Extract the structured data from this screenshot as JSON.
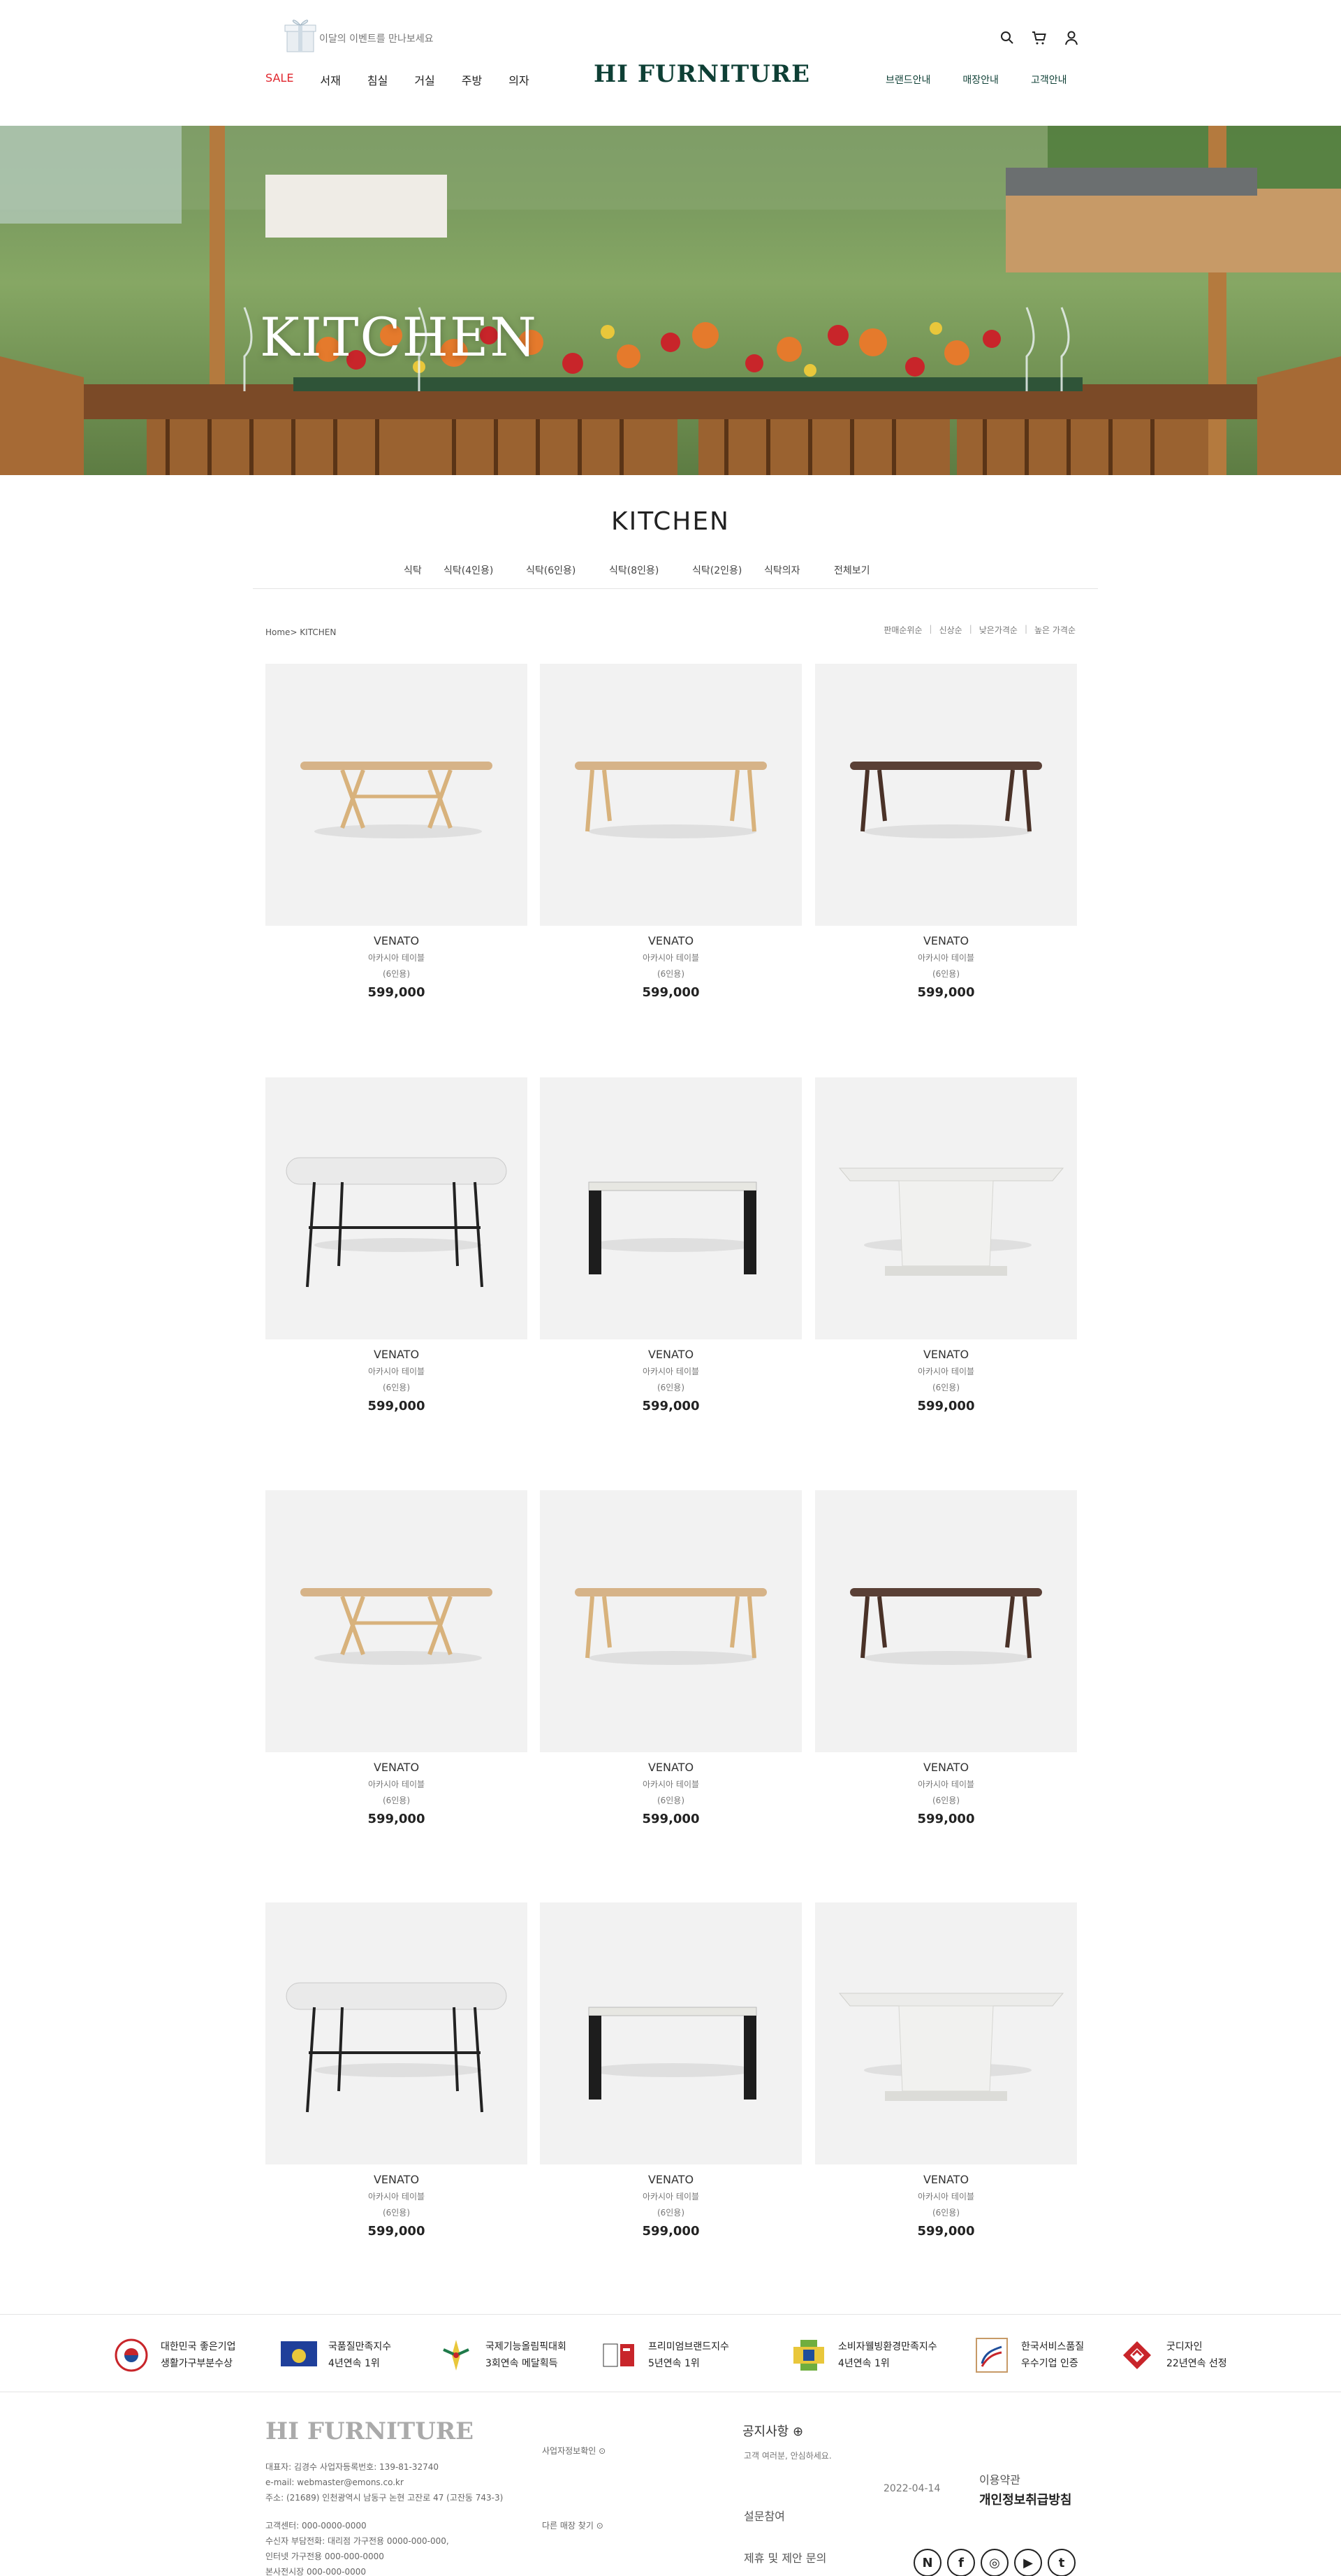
{
  "header": {
    "event_text": "이달의 이벤트를 만나보세요",
    "logo": "HI FURNITURE",
    "nav_left": [
      "SALE",
      "서재",
      "침실",
      "거실",
      "주방",
      "의자"
    ],
    "nav_right": [
      "브랜드안내",
      "매장안내",
      "고객안내"
    ]
  },
  "hero": {
    "title": "KITCHEN"
  },
  "category": {
    "title": "KITCHEN",
    "subnav": [
      "식탁",
      "식탁(4인용)",
      "식탁(6인용)",
      "식탁(8인용)",
      "식탁(2인용)",
      "식탁의자",
      "전체보기"
    ],
    "breadcrumb": "Home> KITCHEN",
    "sort": [
      "판매순위순",
      "신상순",
      "낮은가격순",
      "높은 가격순"
    ]
  },
  "products": [
    {
      "name": "VENATO",
      "sub": "아카시아 테이블",
      "size": "(6인용)",
      "price": "599,000",
      "style": "oak"
    },
    {
      "name": "VENATO",
      "sub": "아카시아 테이블",
      "size": "(6인용)",
      "price": "599,000",
      "style": "natural"
    },
    {
      "name": "VENATO",
      "sub": "아카시아 테이블",
      "size": "(6인용)",
      "price": "599,000",
      "style": "walnut"
    },
    {
      "name": "VENATO",
      "sub": "아카시아 테이블",
      "size": "(6인용)",
      "price": "599,000",
      "style": "marble"
    },
    {
      "name": "VENATO",
      "sub": "아카시아 테이블",
      "size": "(6인용)",
      "price": "599,000",
      "style": "black"
    },
    {
      "name": "VENATO",
      "sub": "아카시아 테이블",
      "size": "(6인용)",
      "price": "599,000",
      "style": "white"
    },
    {
      "name": "VENATO",
      "sub": "아카시아 테이블",
      "size": "(6인용)",
      "price": "599,000",
      "style": "oak"
    },
    {
      "name": "VENATO",
      "sub": "아카시아 테이블",
      "size": "(6인용)",
      "price": "599,000",
      "style": "natural"
    },
    {
      "name": "VENATO",
      "sub": "아카시아 테이블",
      "size": "(6인용)",
      "price": "599,000",
      "style": "walnut"
    },
    {
      "name": "VENATO",
      "sub": "아카시아 테이블",
      "size": "(6인용)",
      "price": "599,000",
      "style": "marble"
    },
    {
      "name": "VENATO",
      "sub": "아카시아 테이블",
      "size": "(6인용)",
      "price": "599,000",
      "style": "black"
    },
    {
      "name": "VENATO",
      "sub": "아카시아 테이블",
      "size": "(6인용)",
      "price": "599,000",
      "style": "white"
    }
  ],
  "awards": [
    {
      "line1": "대한민국 좋은기업",
      "line2": "생활가구부분수상"
    },
    {
      "line1": "국품질만족지수",
      "line2": "4년연속 1위"
    },
    {
      "line1": "국제기능올림픽대회",
      "line2": "3회연속 메달획득"
    },
    {
      "line1": "프리미엄브랜드지수",
      "line2": "5년연속 1위"
    },
    {
      "line1": "소비자웰빙환경만족지수",
      "line2": "4년연속 1위"
    },
    {
      "line1": "한국서비스품질",
      "line2": "우수기업 인증"
    },
    {
      "line1": "굿디자인",
      "line2": "22년연속 선정"
    }
  ],
  "footer": {
    "logo": "HI FURNITURE",
    "info1": "대표자: 김경수    사업자등록번호: 139-81-32740",
    "info2": "e-mail: webmaster@emons.co.kr",
    "info3": "주소: (21689) 인천광역시 남동구 논현 고잔로 47 (고잔동 743-3)",
    "info4": "고객센터: 000-0000-0000",
    "info5": "수신자 부담전화: 대리점 가구전용 0000-000-000,",
    "info6": "인터넷 가구전용 000-000-0000",
    "info7": "본사전시장 000-000-0000",
    "biz_link": "사업자정보확인",
    "store_link": "다른 매장 찾기",
    "notice_title": "공지사항",
    "notice_text": "고객 여러분, 안심하세요.",
    "date": "2022-04-14",
    "policy1": "이용약관",
    "policy2": "개인정보취급방침",
    "survey": "설문참여",
    "proposal": "제휴 및 제안 문의",
    "social": [
      "N",
      "f",
      "◎",
      "▶",
      "t"
    ]
  },
  "colors": {
    "accent": "#0e3f35",
    "sale": "#e0262d"
  }
}
